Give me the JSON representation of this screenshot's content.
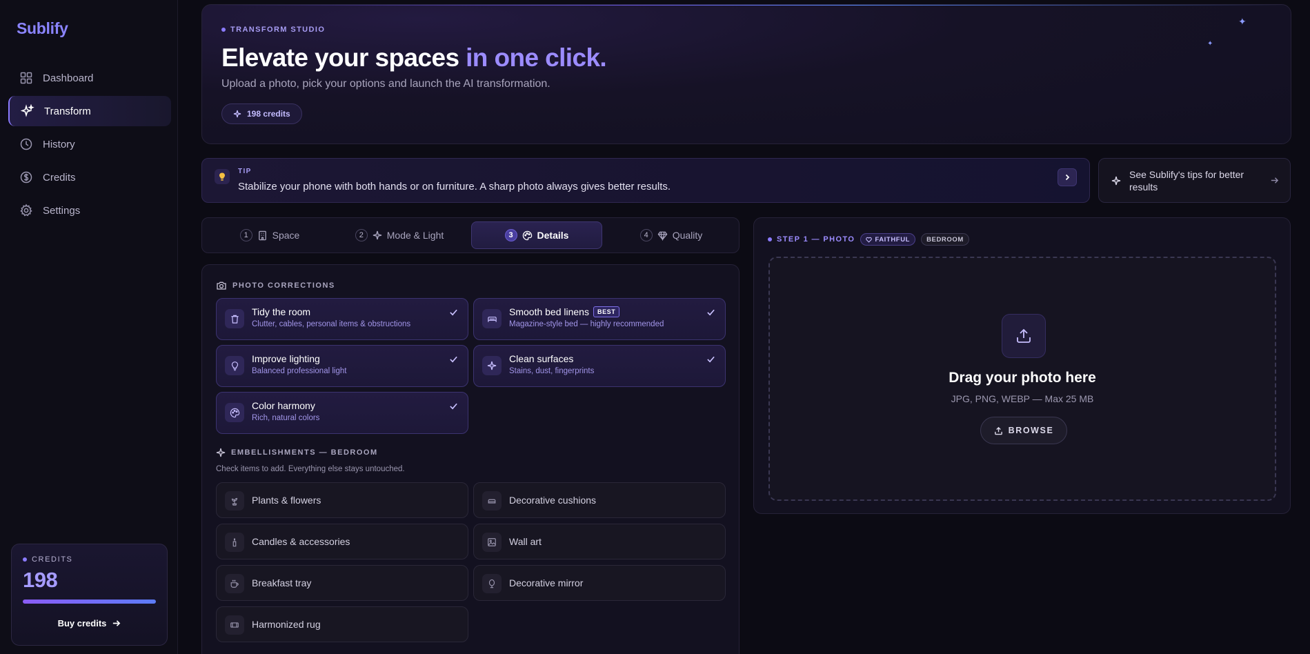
{
  "app": {
    "name": "Sublify"
  },
  "sidebar": {
    "items": [
      {
        "label": "Dashboard",
        "icon": "grid-icon",
        "active": false
      },
      {
        "label": "Transform",
        "icon": "sparkles-icon",
        "active": true
      },
      {
        "label": "History",
        "icon": "clock-icon",
        "active": false
      },
      {
        "label": "Credits",
        "icon": "dollar-icon",
        "active": false
      },
      {
        "label": "Settings",
        "icon": "gear-icon",
        "active": false
      }
    ],
    "credits": {
      "label": "CREDITS",
      "value": "198",
      "level_fraction": 1.0,
      "buy_label": "Buy credits"
    }
  },
  "hero": {
    "kicker": "TRANSFORM STUDIO",
    "title_main": "Elevate your spaces ",
    "title_accent": "in one click.",
    "subtitle": "Upload a photo, pick your options and launch the AI transformation.",
    "credits_pill": "198 credits"
  },
  "tip": {
    "label": "TIP",
    "text": "Stabilize your phone with both hands or on furniture. A sharp photo always gives better results.",
    "tips_link": "See Sublify's tips for better results"
  },
  "steps": [
    {
      "num": "1",
      "label": "Space",
      "icon": "building-icon",
      "active": false
    },
    {
      "num": "2",
      "label": "Mode & Light",
      "icon": "sparkle-icon",
      "active": false
    },
    {
      "num": "3",
      "label": "Details",
      "icon": "palette-icon",
      "active": true
    },
    {
      "num": "4",
      "label": "Quality",
      "icon": "diamond-icon",
      "active": false
    }
  ],
  "corrections": {
    "title": "PHOTO CORRECTIONS",
    "items": [
      {
        "title": "Tidy the room",
        "desc": "Clutter, cables, personal items & obstructions",
        "icon": "trash-icon",
        "checked": true
      },
      {
        "title": "Smooth bed linens",
        "badge": "BEST",
        "desc": "Magazine-style bed — highly recommended",
        "icon": "bed-icon",
        "checked": true
      },
      {
        "title": "Improve lighting",
        "desc": "Balanced professional light",
        "icon": "bulb-icon",
        "checked": true
      },
      {
        "title": "Clean surfaces",
        "desc": "Stains, dust, fingerprints",
        "icon": "sparkle-icon",
        "checked": true
      },
      {
        "title": "Color harmony",
        "desc": "Rich, natural colors",
        "icon": "palette-icon",
        "checked": true
      }
    ]
  },
  "embellishments": {
    "title": "EMBELLISHMENTS — BEDROOM",
    "hint": "Check items to add. Everything else stays untouched.",
    "items": [
      {
        "title": "Plants & flowers",
        "icon": "plant-icon"
      },
      {
        "title": "Decorative cushions",
        "icon": "cushion-icon"
      },
      {
        "title": "Candles & accessories",
        "icon": "candle-icon"
      },
      {
        "title": "Wall art",
        "icon": "image-icon"
      },
      {
        "title": "Breakfast tray",
        "icon": "coffee-icon"
      },
      {
        "title": "Decorative mirror",
        "icon": "mirror-icon"
      },
      {
        "title": "Harmonized rug",
        "icon": "rug-icon"
      }
    ]
  },
  "upload": {
    "step_label": "STEP 1 — PHOTO",
    "chip_mode": "FAITHFUL",
    "chip_room": "BEDROOM",
    "title": "Drag your photo here",
    "formats": "JPG, PNG, WEBP — Max 25 MB",
    "browse": "BROWSE"
  }
}
